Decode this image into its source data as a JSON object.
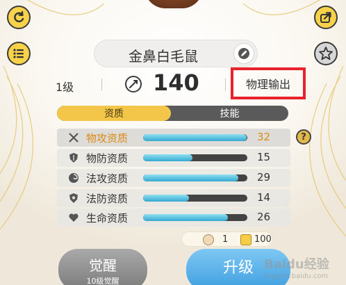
{
  "pet": {
    "name": "金鼻白毛鼠",
    "level": "1级",
    "power": "140",
    "role": "物理输出"
  },
  "tabs": [
    {
      "label": "资质",
      "active": true
    },
    {
      "label": "技能",
      "active": false
    }
  ],
  "attributes": [
    {
      "label": "物攻资质",
      "value": "32",
      "fill": 0.99,
      "icon": "swords-icon",
      "highlight": true
    },
    {
      "label": "物防资质",
      "value": "15",
      "fill": 0.47,
      "icon": "shield-icon",
      "highlight": false
    },
    {
      "label": "法攻资质",
      "value": "29",
      "fill": 0.91,
      "icon": "magic-swirl-icon",
      "highlight": false
    },
    {
      "label": "法防资质",
      "value": "14",
      "fill": 0.44,
      "icon": "magic-shield-icon",
      "highlight": false
    },
    {
      "label": "生命资质",
      "value": "26",
      "fill": 0.81,
      "icon": "heart-icon",
      "highlight": false
    }
  ],
  "help_label": "?",
  "cost": {
    "item_count": "1",
    "coin_count": "100"
  },
  "buttons": {
    "awaken": "觉醒",
    "awaken_sub": "10级觉醒",
    "upgrade": "升级"
  },
  "watermark": {
    "brand": "Baidu经验",
    "domain": "jingyan.baidu.com"
  },
  "colors": {
    "accent_yellow": "#f3c64a",
    "highlight_red": "#e8222c",
    "orange_text": "#d98a18",
    "bar_fill": "#35a9d3"
  }
}
